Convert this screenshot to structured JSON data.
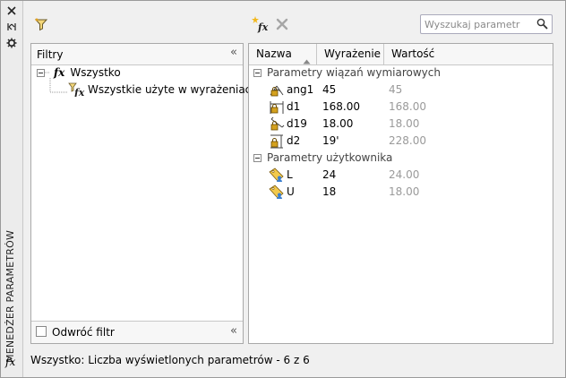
{
  "rail": {
    "title": "MENEDŻER PARAMETRÓW",
    "fx_symbol": "fx"
  },
  "toolbar": {
    "search_placeholder": "Wyszukaj parametr",
    "icons": [
      "filter-icon",
      "new-user-parameter-icon",
      "delete-parameter-icon",
      "search-icon"
    ]
  },
  "filters": {
    "header": "Filtry",
    "collapse_symbol": "«",
    "tree": [
      {
        "label": "Wszystko",
        "icon": "fx-icon",
        "expand": "−"
      },
      {
        "label": "Wszystkie użyte w wyrażeniach",
        "icon": "fx-filter-icon"
      }
    ],
    "invert_label": "Odwróć filtr",
    "invert_checked": false
  },
  "table": {
    "columns": {
      "name": "Nazwa",
      "expression": "Wyrażenie",
      "value": "Wartość"
    },
    "groups": [
      {
        "label": "Parametry wiązań wymiarowych",
        "rows": [
          {
            "name": "ang1",
            "expression": "45",
            "value": "45",
            "icon": "angular-dimension-icon"
          },
          {
            "name": "d1",
            "expression": "168.00",
            "value": "168.00",
            "icon": "horizontal-dimension-icon"
          },
          {
            "name": "d19",
            "expression": "18.00",
            "value": "18.00",
            "icon": "aligned-dimension-icon"
          },
          {
            "name": "d2",
            "expression": "19'",
            "value": "228.00",
            "icon": "vertical-dimension-icon"
          }
        ]
      },
      {
        "label": "Parametry użytkownika",
        "rows": [
          {
            "name": "L",
            "expression": "24",
            "value": "24.00",
            "icon": "user-parameter-icon"
          },
          {
            "name": "U",
            "expression": "18",
            "value": "18.00",
            "icon": "user-parameter-icon"
          }
        ]
      }
    ]
  },
  "status": "Wszystko: Liczba wyświetlonych parametrów - 6 z 6",
  "colors": {
    "panel_border": "#a9a9a9",
    "value_gray": "#9a9a9a",
    "lock_gold": "#d4a11e"
  }
}
